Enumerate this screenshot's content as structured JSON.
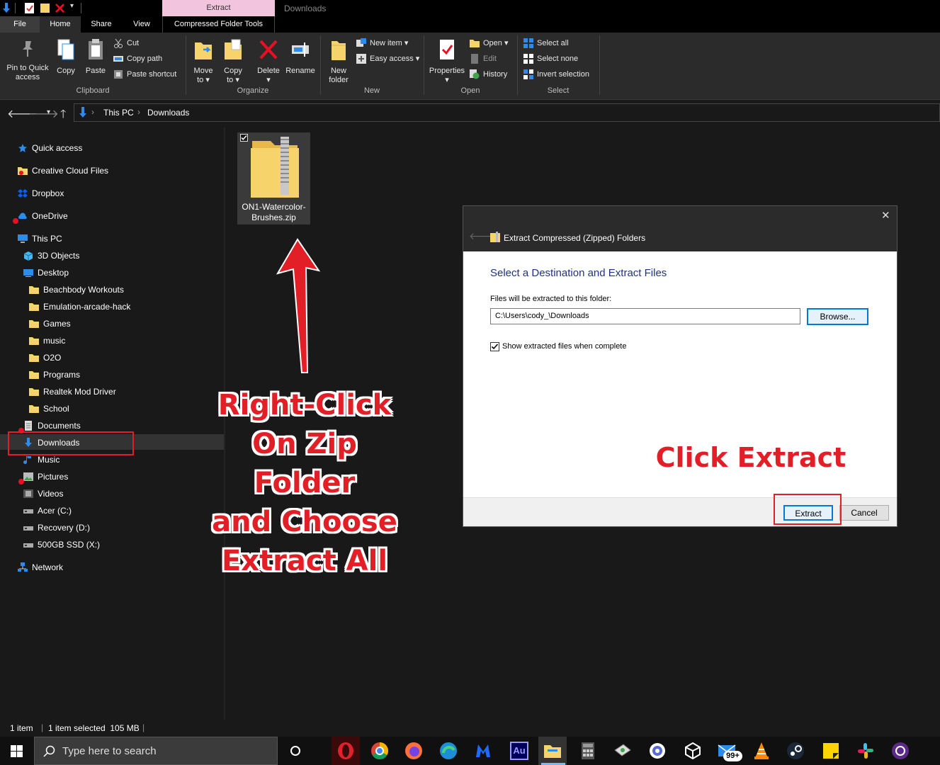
{
  "window": {
    "context_tab": "Extract",
    "title": "Downloads"
  },
  "ribbon_tabs": {
    "file": "File",
    "home": "Home",
    "share": "Share",
    "view": "View",
    "compressed": "Compressed Folder Tools"
  },
  "clipboard": {
    "pin_line1": "Pin to Quick",
    "pin_line2": "access",
    "copy": "Copy",
    "paste": "Paste",
    "cut": "Cut",
    "copy_path": "Copy path",
    "paste_shortcut": "Paste shortcut",
    "group": "Clipboard"
  },
  "organize": {
    "move_line1": "Move",
    "move_line2": "to ▾",
    "copy_line1": "Copy",
    "copy_line2": "to ▾",
    "delete_line1": "Delete",
    "delete_line2": "▾",
    "rename": "Rename",
    "group": "Organize"
  },
  "new": {
    "folder_line1": "New",
    "folder_line2": "folder",
    "new_item": "New item ▾",
    "easy_access": "Easy access ▾",
    "group": "New"
  },
  "open": {
    "properties_line1": "Properties",
    "properties_line2": "▾",
    "open": "Open ▾",
    "edit": "Edit",
    "history": "History",
    "group": "Open"
  },
  "select": {
    "select_all": "Select all",
    "select_none": "Select none",
    "invert": "Invert selection",
    "group": "Select"
  },
  "address": {
    "crumb1": "This PC",
    "crumb2": "Downloads"
  },
  "sidebar": {
    "items": [
      "Quick access",
      "Creative Cloud Files",
      "Dropbox",
      "OneDrive",
      "This PC",
      "3D Objects",
      "Desktop",
      "Beachbody Workouts",
      "Emulation-arcade-hack",
      "Games",
      "music",
      "O2O",
      "Programs",
      "Realtek Mod Driver",
      "School",
      "Documents",
      "Downloads",
      "Music",
      "Pictures",
      "Videos",
      "Acer (C:)",
      "Recovery (D:)",
      "500GB SSD (X:)",
      "Network"
    ]
  },
  "file": {
    "name_line1": "ON1-Watercolor-",
    "name_line2": "Brushes.zip"
  },
  "dialog": {
    "title": "Extract Compressed (Zipped) Folders",
    "heading": "Select a Destination and Extract Files",
    "label": "Files will be extracted to this folder:",
    "path": "C:\\Users\\cody_\\Downloads",
    "browse": "Browse...",
    "checkbox_label": "Show extracted files when complete",
    "checkbox_checked": true,
    "extract": "Extract",
    "cancel": "Cancel",
    "close": "✕"
  },
  "annotations": {
    "left_line1": "Right-Click",
    "left_line2": "On Zip Folder",
    "left_line3": "and Choose",
    "left_line4": "Extract All",
    "right": "Click Extract"
  },
  "status": {
    "count": "1 item",
    "selection": "1 item selected  105 MB"
  },
  "taskbar": {
    "search_placeholder": "Type here to search",
    "mail_badge": "99+",
    "audition_label": "Au"
  },
  "colors": {
    "annotation_red": "#e21f26",
    "dialog_heading_blue": "#1e3287",
    "folder_yellow": "#f6d36b"
  }
}
